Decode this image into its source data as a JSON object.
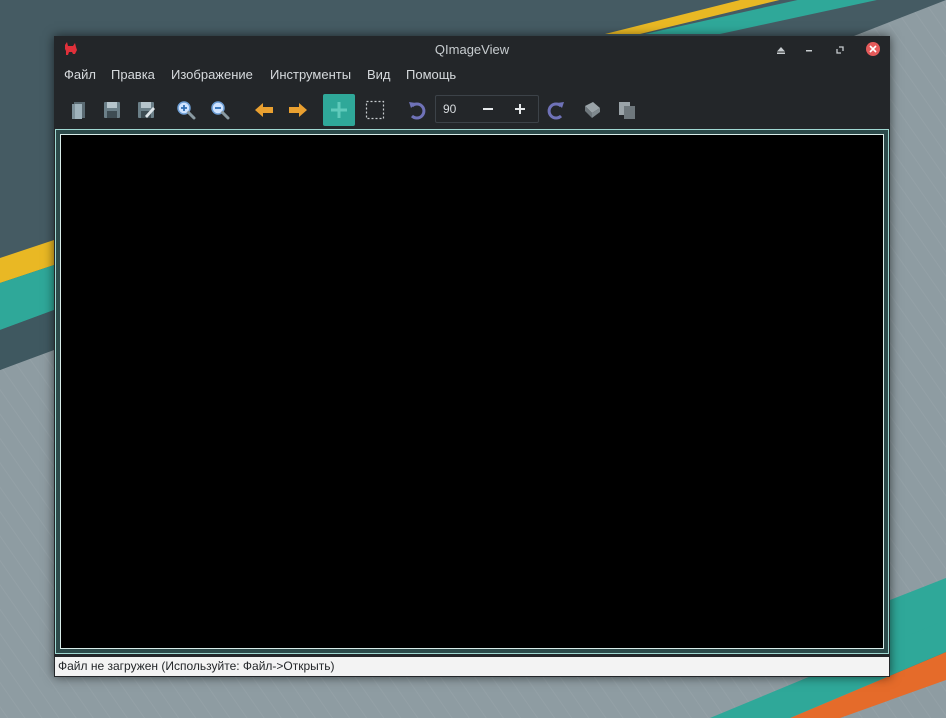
{
  "window": {
    "title": "QImageView"
  },
  "menubar": {
    "items": [
      "Файл",
      "Правка",
      "Изображение",
      "Инструменты",
      "Вид",
      "Помощь"
    ]
  },
  "toolbar": {
    "icons": [
      "open-file-icon",
      "save-icon",
      "save-as-icon",
      "zoom-in-icon",
      "zoom-out-icon",
      "arrow-left-icon",
      "arrow-right-icon",
      "move-icon",
      "select-rectangle-icon",
      "rotate-counterclockwise-icon",
      "rotate-clockwise-icon",
      "paste-icon",
      "copy-icon"
    ],
    "rotate_angle": "90",
    "decrease_label": "−",
    "increase_label": "+"
  },
  "status": {
    "text": "Файл не загружен (Используйте: Файл->Открыть)"
  },
  "colors": {
    "accent": "#2fa899",
    "window_bg": "#232629",
    "canvas_bg": "#000000",
    "arrow": "#e9a030",
    "close_button": "#e45a5a"
  }
}
